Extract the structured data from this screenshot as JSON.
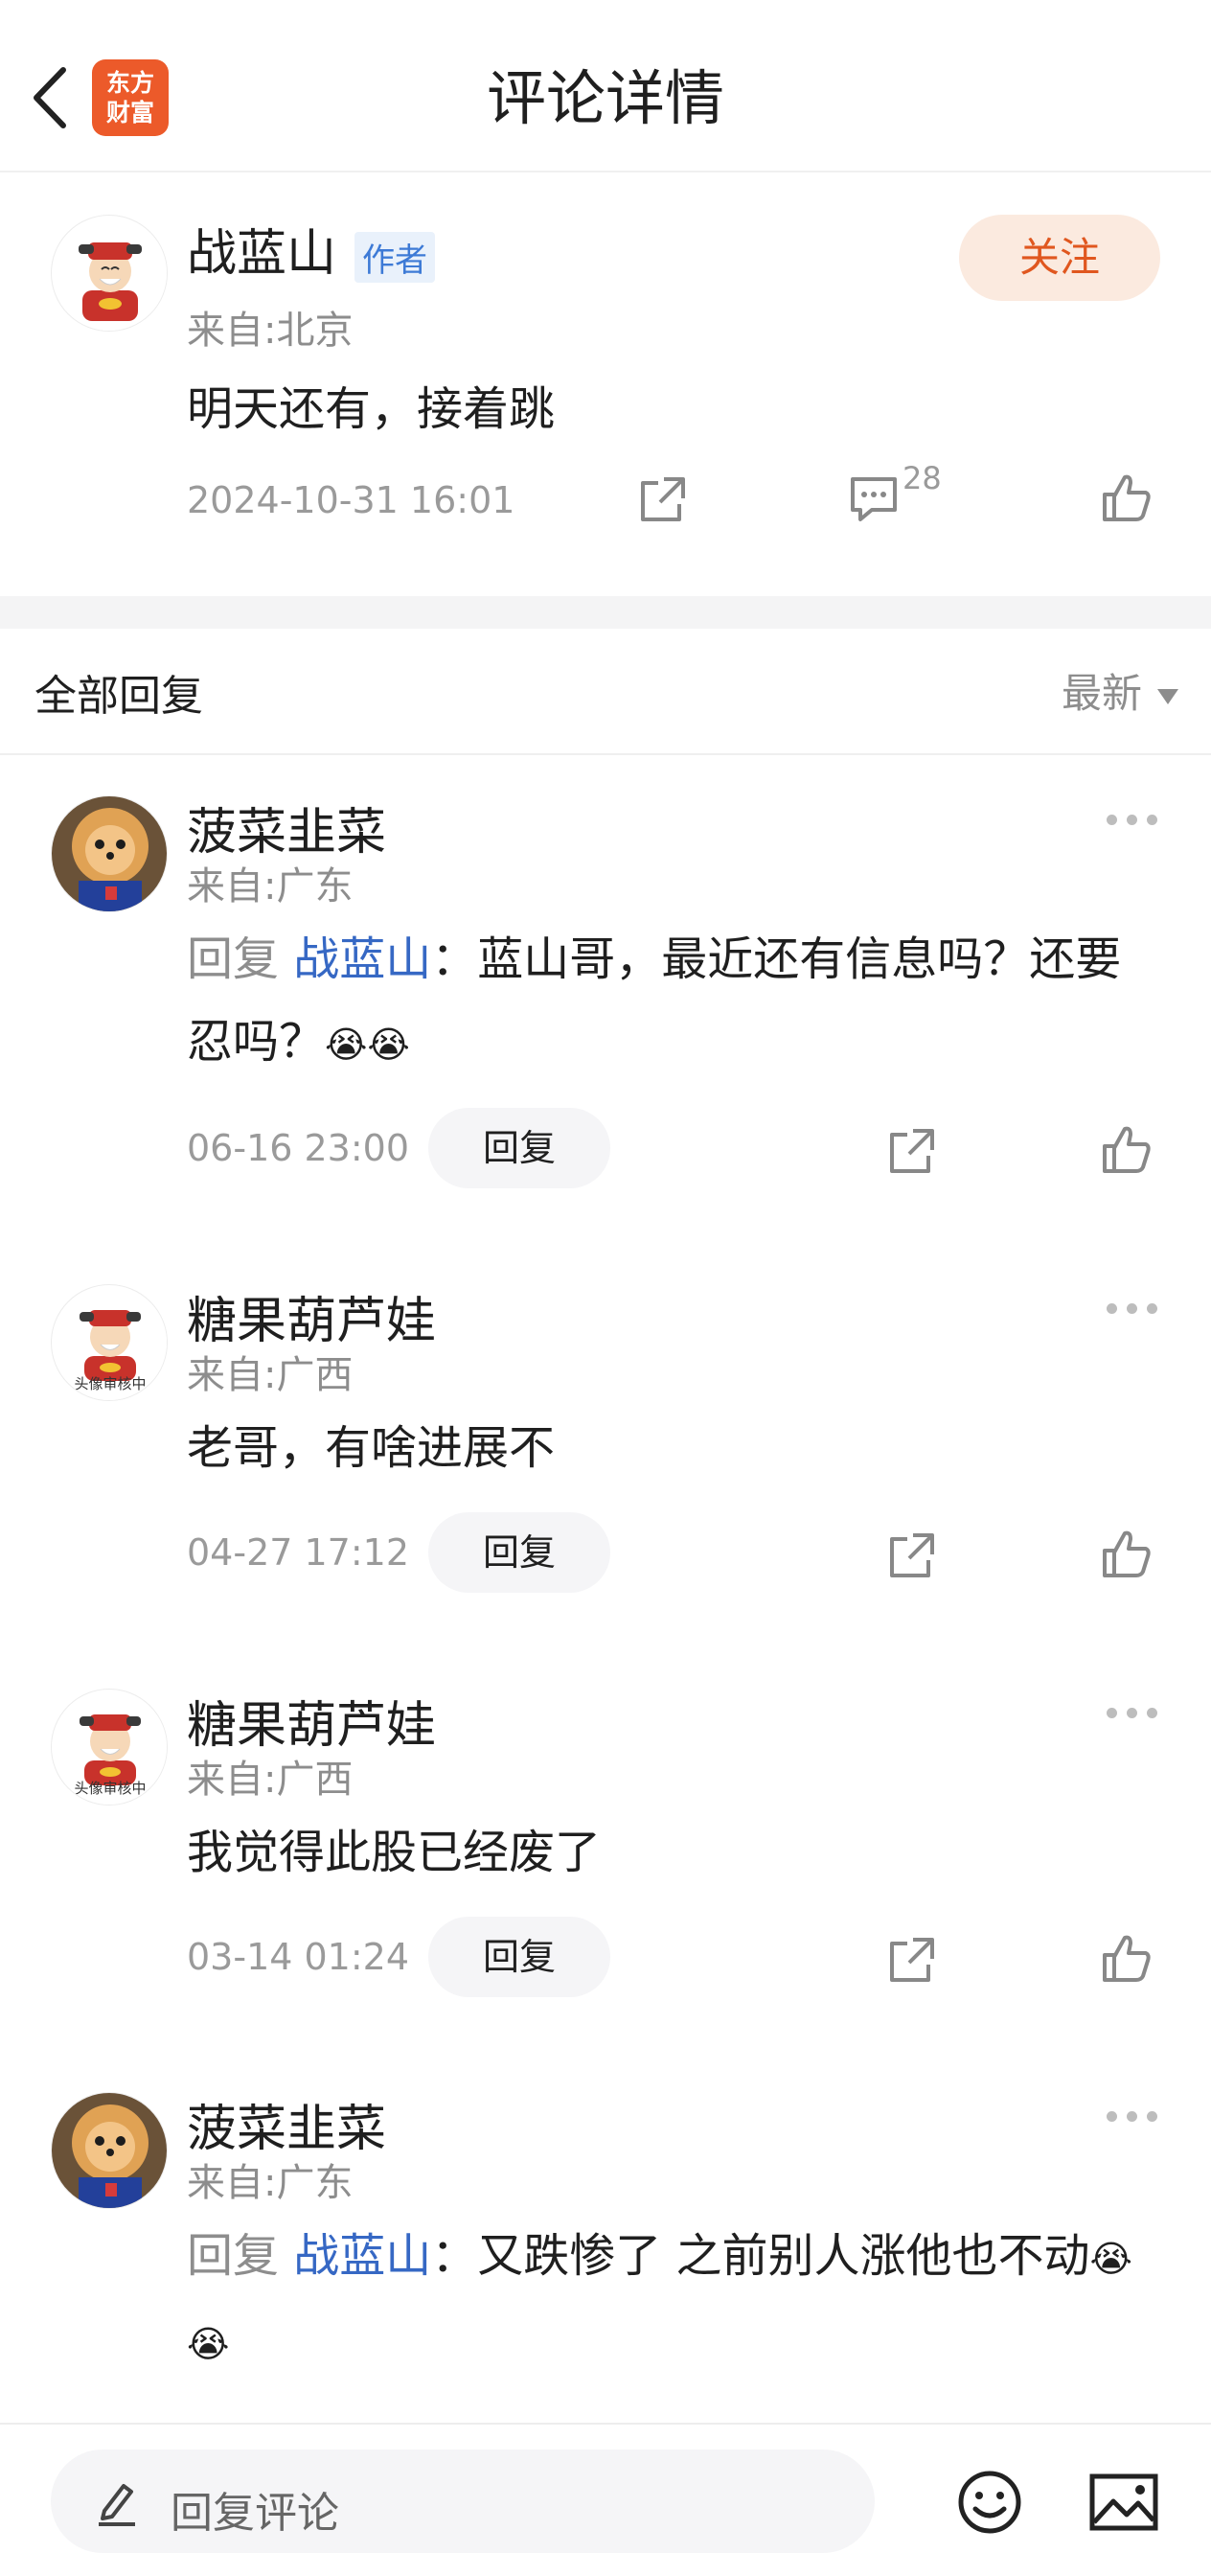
{
  "header": {
    "title": "评论详情",
    "logo_line1": "东方",
    "logo_line2": "财富"
  },
  "post": {
    "author": "战蓝山",
    "author_tag": "作者",
    "follow_label": "关注",
    "location": "来自:北京",
    "text": "明天还有，接着跳",
    "time": "2024-10-31 16:01",
    "comment_count": "28"
  },
  "replies_section": {
    "title": "全部回复",
    "sort_label": "最新"
  },
  "replies": [
    {
      "name": "菠菜韭菜",
      "location": "来自:广东",
      "prefix": "回复 ",
      "target": "战蓝山",
      "text": "：蓝山哥，最近还有信息吗？还要忍吗？",
      "emoji": "😭😭",
      "time": "06-16 23:00",
      "reply_label": "回复"
    },
    {
      "name": "糖果葫芦娃",
      "location": "来自:广西",
      "text": "老哥，有啥进展不",
      "time": "04-27 17:12",
      "reply_label": "回复",
      "avatar_caption": "头像审核中"
    },
    {
      "name": "糖果葫芦娃",
      "location": "来自:广西",
      "text": "我觉得此股已经废了",
      "time": "03-14 01:24",
      "reply_label": "回复",
      "avatar_caption": "头像审核中"
    },
    {
      "name": "菠菜韭菜",
      "location": "来自:广东",
      "prefix": "回复 ",
      "target": "战蓝山",
      "text": "：又跌惨了 之前别人涨他也不动",
      "emoji": "😭😭"
    }
  ],
  "bottom_bar": {
    "input_placeholder": "回复评论"
  }
}
